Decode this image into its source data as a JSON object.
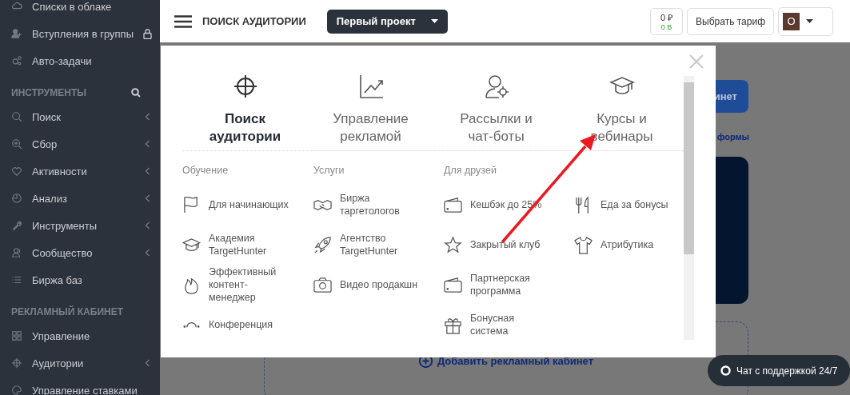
{
  "sidebar": {
    "sections": [
      {
        "items": [
          {
            "label": "Списки в облаке",
            "expandable": false,
            "locked": false
          },
          {
            "label": "Вступления в группы",
            "expandable": false,
            "locked": true
          },
          {
            "label": "Авто-задачи",
            "expandable": false,
            "locked": false
          }
        ]
      },
      {
        "title": "ИНСТРУМЕНТЫ",
        "search": true,
        "items": [
          {
            "label": "Поиск",
            "expandable": true,
            "locked": false
          },
          {
            "label": "Сбор",
            "expandable": true,
            "locked": false
          },
          {
            "label": "Активности",
            "expandable": true,
            "locked": false
          },
          {
            "label": "Анализ",
            "expandable": true,
            "locked": false
          },
          {
            "label": "Инструменты",
            "expandable": true,
            "locked": false
          },
          {
            "label": "Сообщество",
            "expandable": true,
            "locked": false
          },
          {
            "label": "Биржа баз",
            "expandable": false,
            "locked": false
          }
        ]
      },
      {
        "title": "РЕКЛАМНЫЙ КАБИНЕТ",
        "search": false,
        "items": [
          {
            "label": "Управление",
            "expandable": false,
            "locked": false
          },
          {
            "label": "Аудитории",
            "expandable": true,
            "locked": false
          },
          {
            "label": "Управление ставками",
            "expandable": false,
            "locked": false
          }
        ]
      }
    ]
  },
  "header": {
    "page_title": "ПОИСК АУДИТОРИИ",
    "project": "Первый проект",
    "balance": {
      "money": "0 ₽",
      "bonus": "0 В"
    },
    "plan_button": "Выбрать тариф",
    "avatar": "О"
  },
  "background": {
    "button": "инет",
    "link": "формы",
    "add_link": "Добавить рекламный кабинет"
  },
  "modal": {
    "tabs": [
      {
        "label": "Поиск аудитории",
        "selected": true
      },
      {
        "label": "Управление рекламой",
        "selected": false
      },
      {
        "label": "Рассылки и чат-боты",
        "selected": false
      },
      {
        "label": "Курсы и вебинары",
        "selected": false
      }
    ],
    "columns": [
      {
        "heading": "Обучение",
        "items": [
          "Для начинающих",
          "Академия\nTargetHunter",
          "Эффективный\nконтент-\nменеджер",
          "Конференция"
        ]
      },
      {
        "heading": "Услуги",
        "items": [
          "Биржа\nтаргетологов",
          "Агентство\nTargetHunter",
          "Видео продакшн"
        ]
      },
      {
        "heading": "Для друзей",
        "items": [
          "Кешбэк до 25%",
          "Закрытый клуб",
          "Партнерская\nпрограмма",
          "Бонусная\nсистема"
        ]
      },
      {
        "items": [
          "Еда за бонусы",
          "Атрибутика"
        ]
      }
    ]
  },
  "chat_button": "Чат с поддержкой 24/7"
}
